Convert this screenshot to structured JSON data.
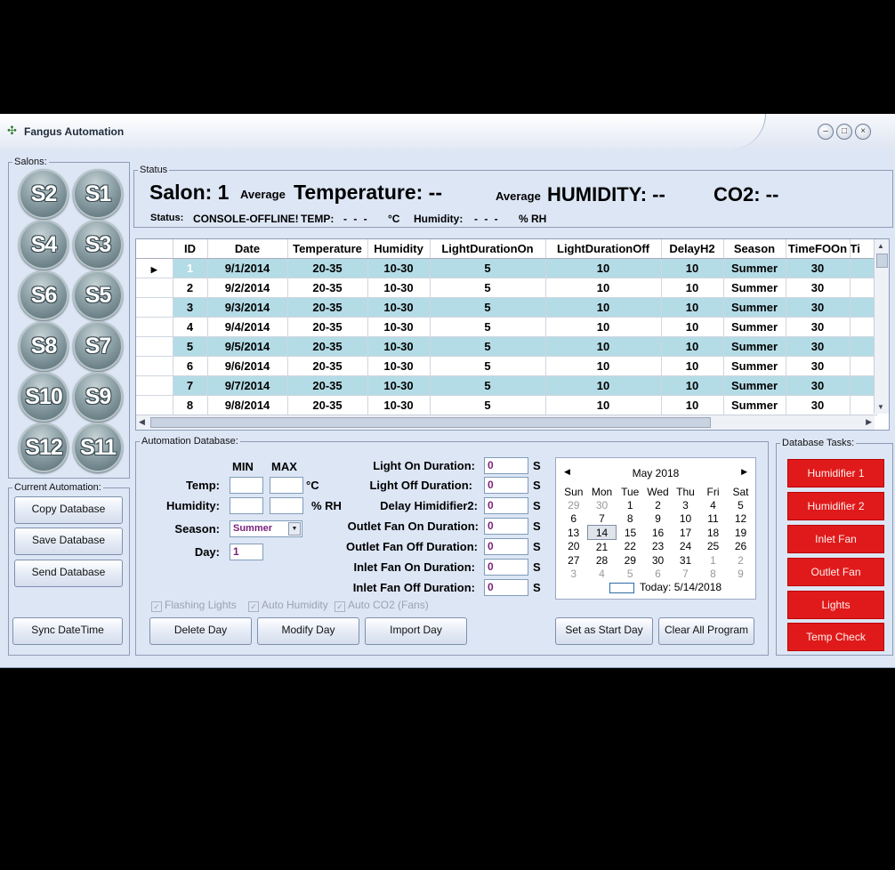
{
  "window": {
    "title": "Fangus Automation"
  },
  "salons": {
    "legend": "Salons:",
    "buttons": [
      "S2",
      "S1",
      "S4",
      "S3",
      "S6",
      "S5",
      "S8",
      "S7",
      "S10",
      "S9",
      "S12",
      "S11"
    ]
  },
  "current_automation": {
    "legend": "Current Automation:",
    "copy": "Copy Database",
    "save": "Save Database",
    "send": "Send Database",
    "sync": "Sync DateTime"
  },
  "status": {
    "legend": "Status",
    "salon": "Salon: 1",
    "avg1": "Average",
    "temperature": "Temperature: --",
    "avg2": "Average",
    "humidity": "HUMIDITY: --",
    "co2": "CO2: --",
    "status_label": "Status:",
    "status_value": "CONSOLE-OFFLINE!",
    "temp_label": "TEMP:",
    "temp_dashes": "- - -",
    "temp_unit": "°C",
    "hum_label": "Humidity:",
    "hum_dashes": "- - -",
    "hum_unit": "% RH"
  },
  "grid": {
    "columns": [
      "ID",
      "Date",
      "Temperature",
      "Humidity",
      "LightDurationOn",
      "LightDurationOff",
      "DelayH2",
      "Season",
      "TimeFOOn",
      "Ti"
    ],
    "rows": [
      [
        "1",
        "9/1/2014",
        "20-35",
        "10-30",
        "5",
        "10",
        "10",
        "Summer",
        "30"
      ],
      [
        "2",
        "9/2/2014",
        "20-35",
        "10-30",
        "5",
        "10",
        "10",
        "Summer",
        "30"
      ],
      [
        "3",
        "9/3/2014",
        "20-35",
        "10-30",
        "5",
        "10",
        "10",
        "Summer",
        "30"
      ],
      [
        "4",
        "9/4/2014",
        "20-35",
        "10-30",
        "5",
        "10",
        "10",
        "Summer",
        "30"
      ],
      [
        "5",
        "9/5/2014",
        "20-35",
        "10-30",
        "5",
        "10",
        "10",
        "Summer",
        "30"
      ],
      [
        "6",
        "9/6/2014",
        "20-35",
        "10-30",
        "5",
        "10",
        "10",
        "Summer",
        "30"
      ],
      [
        "7",
        "9/7/2014",
        "20-35",
        "10-30",
        "5",
        "10",
        "10",
        "Summer",
        "30"
      ],
      [
        "8",
        "9/8/2014",
        "20-35",
        "10-30",
        "5",
        "10",
        "10",
        "Summer",
        "30"
      ]
    ]
  },
  "automation_db": {
    "legend": "Automation Database:",
    "min": "MIN",
    "max": "MAX",
    "temp_label": "Temp:",
    "temp_unit": "°C",
    "hum_label": "Humidity:",
    "hum_unit": "% RH",
    "season_label": "Season:",
    "season_value": "Summer",
    "day_label": "Day:",
    "day_value": "1",
    "light_on": "Light On Duration:",
    "light_off": "Light Off Duration:",
    "delay_h2": "Delay Himidifier2:",
    "outlet_on": "Outlet Fan On Duration:",
    "outlet_off": "Outlet Fan Off Duration:",
    "inlet_on": "Inlet Fan On Duration:",
    "inlet_off": "Inlet Fan Off Duration:",
    "dur_values": [
      "0",
      "0",
      "0",
      "0",
      "0",
      "0",
      "0"
    ],
    "s_unit": "S",
    "chk_flashing": "Flashing Lights",
    "chk_auto_hum": "Auto Humidity",
    "chk_auto_co2": "Auto CO2 (Fans)",
    "delete_day": "Delete Day",
    "modify_day": "Modify Day",
    "import_day": "Import Day",
    "set_start": "Set as Start Day",
    "clear_all": "Clear All Program"
  },
  "calendar": {
    "month": "May 2018",
    "days": [
      "Sun",
      "Mon",
      "Tue",
      "Wed",
      "Thu",
      "Fri",
      "Sat"
    ],
    "weeks": [
      [
        "29",
        "30",
        "1",
        "2",
        "3",
        "4",
        "5"
      ],
      [
        "6",
        "7",
        "8",
        "9",
        "10",
        "11",
        "12"
      ],
      [
        "13",
        "14",
        "15",
        "16",
        "17",
        "18",
        "19"
      ],
      [
        "20",
        "21",
        "22",
        "23",
        "24",
        "25",
        "26"
      ],
      [
        "27",
        "28",
        "29",
        "30",
        "31",
        "1",
        "2"
      ],
      [
        "3",
        "4",
        "5",
        "6",
        "7",
        "8",
        "9"
      ]
    ],
    "today": "Today: 5/14/2018"
  },
  "db_tasks": {
    "legend": "Database Tasks:",
    "buttons": [
      "Humidifier 1",
      "Humidifier 2",
      "Inlet Fan",
      "Outlet Fan",
      "Lights",
      "Temp Check"
    ],
    "color": "#e01a1a"
  }
}
